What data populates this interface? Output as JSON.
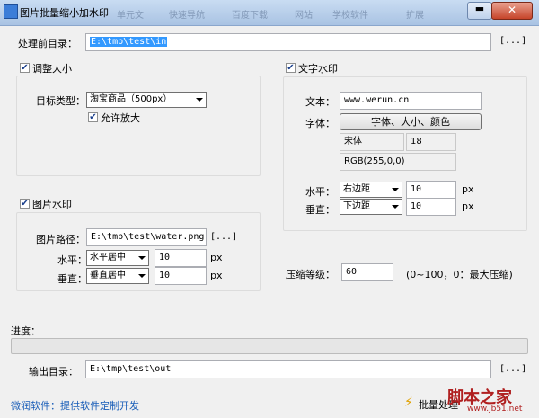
{
  "window": {
    "title": "图片批量缩小加水印",
    "background_tabs": [
      "单元文",
      "快速导航",
      "百度下载",
      "网站",
      "学校软件",
      "扩展"
    ],
    "minimize_label": "▬",
    "close_label": "✕"
  },
  "source": {
    "label": "处理前目录：",
    "value": "E:\\tmp\\test\\in",
    "browse_label": "[...]"
  },
  "resize": {
    "checkbox_label": "调整大小",
    "checked": true,
    "target_type_label": "目标类型：",
    "target_type_value": "淘宝商品（500px）",
    "allow_enlarge_label": "允许放大",
    "allow_enlarge_checked": true
  },
  "image_watermark": {
    "checkbox_label": "图片水印",
    "checked": true,
    "path_label": "图片路径：",
    "path_value": "E:\\tmp\\test\\water.png",
    "browse_label": "[...]",
    "horizontal_label": "水平：",
    "horizontal_value": "水平居中",
    "horizontal_offset": "10",
    "vertical_label": "垂直：",
    "vertical_value": "垂直居中",
    "vertical_offset": "10",
    "unit": "px"
  },
  "text_watermark": {
    "checkbox_label": "文字水印",
    "checked": true,
    "text_label": "文本：",
    "text_value": "www.werun.cn",
    "font_label": "字体：",
    "font_button_label": "字体、大小、颜色",
    "font_name": "宋体",
    "font_size": "18",
    "color_value": "RGB(255,0,0)",
    "horizontal_label": "水平：",
    "horizontal_value": "右边距",
    "horizontal_offset": "10",
    "vertical_label": "垂直：",
    "vertical_value": "下边距",
    "vertical_offset": "10",
    "unit": "px"
  },
  "compression": {
    "label": "压缩等级：",
    "value": "60",
    "hint": "(0~100，0：最大压缩)"
  },
  "progress": {
    "label": "进度：",
    "fraction": 0,
    "color": "#3cb043"
  },
  "output": {
    "label": "输出目录：",
    "value": "E:\\tmp\\test\\out",
    "browse_label": "[...]"
  },
  "footer": {
    "link_text": "微润软件：提供软件定制开发",
    "run_label": "批量处理",
    "run_icon": "lightning-icon",
    "watermark_text": "脚本之家",
    "watermark_url": "www.jb51.net"
  }
}
